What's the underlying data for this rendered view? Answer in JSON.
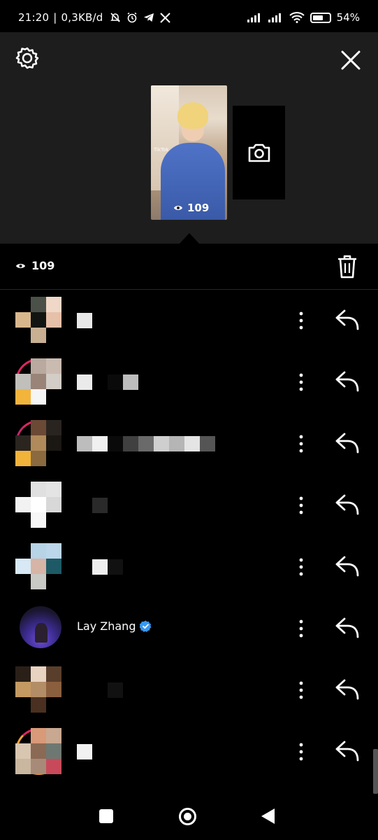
{
  "status_bar": {
    "time": "21:20",
    "separator": "|",
    "net_speed": "0,3KB/d",
    "battery": "54",
    "battery_fraction": 0.54
  },
  "story": {
    "views": "109",
    "thumbnail_watermark": "TikTok"
  },
  "summary": {
    "views": "109"
  },
  "viewers": [
    {
      "name": "",
      "pixelated": true
    },
    {
      "name": "",
      "pixelated": true
    },
    {
      "name": "",
      "pixelated": true
    },
    {
      "name": "",
      "pixelated": true
    },
    {
      "name": "",
      "pixelated": true
    },
    {
      "name": "Lay Zhang",
      "verified": true,
      "pixelated": false
    },
    {
      "name": "",
      "pixelated": true
    },
    {
      "name": "",
      "pixelated": true
    }
  ],
  "colors": {
    "panel_bg": "#1d1d1d",
    "list_bg": "#000000",
    "verified_blue": "#3897f0",
    "story_ring": "#e0245e"
  },
  "icons": {
    "settings": "gear-icon",
    "close": "close-icon",
    "camera": "camera-icon",
    "eye": "eye-icon",
    "delete": "trash-icon",
    "more": "more-vertical-icon",
    "reply": "reply-icon"
  }
}
